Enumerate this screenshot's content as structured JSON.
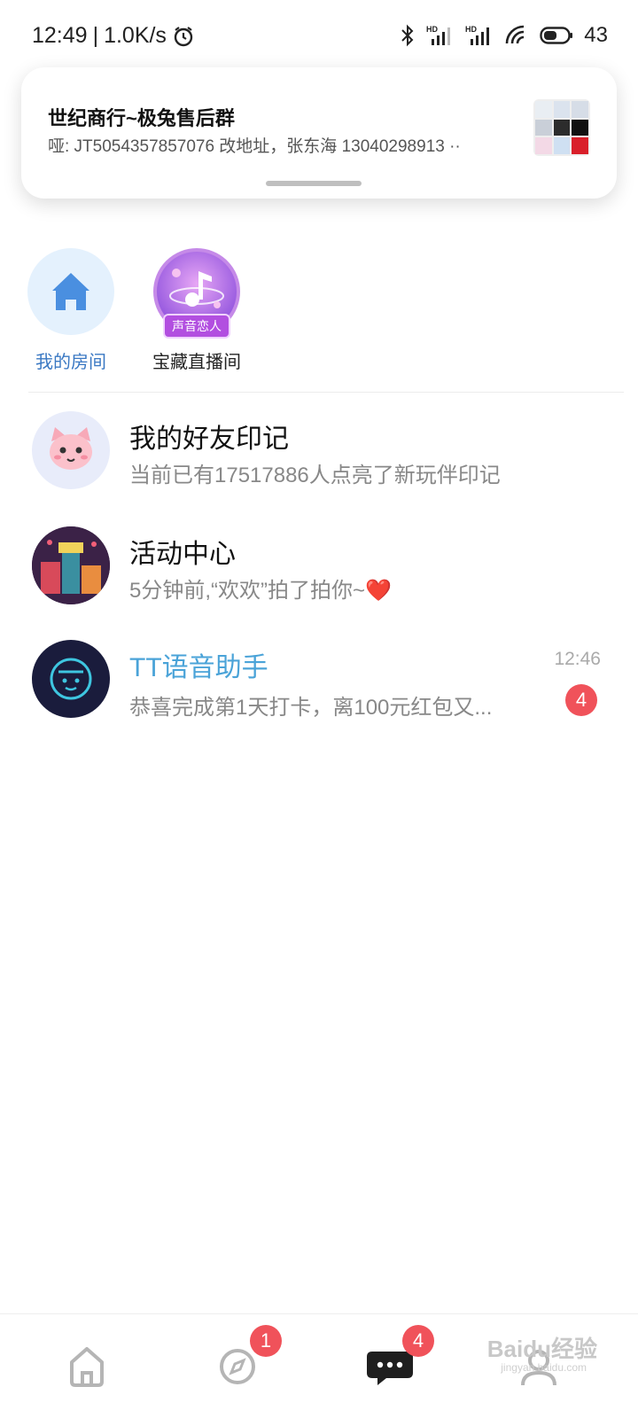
{
  "status_bar": {
    "time": "12:49",
    "speed": "1.0K/s",
    "battery": "43",
    "icons": [
      "alarm-icon",
      "bluetooth-icon",
      "signal-hd-icon",
      "signal-hd-icon",
      "wifi-icon",
      "battery-icon"
    ]
  },
  "notification": {
    "title": "世纪商行~极兔售后群",
    "body": "哑: JT5054357857076  改地址，张东海 13040298913 ··"
  },
  "rooms": [
    {
      "label": "我的房间",
      "icon": "home-icon"
    },
    {
      "label": "宝藏直播间",
      "badge": "声音恋人",
      "icon": "music-note-icon"
    }
  ],
  "conversations": [
    {
      "title": "我的好友印记",
      "subtitle": "当前已有17517886人点亮了新玩伴印记",
      "avatar": "cat-avatar"
    },
    {
      "title": "活动中心",
      "subtitle": "5分钟前,“欢欢”拍了拍你~❤️",
      "avatar": "activity-avatar"
    },
    {
      "title": "TT语音助手",
      "subtitle": "恭喜完成第1天打卡，离100元红包又...",
      "time": "12:46",
      "unread": "4",
      "avatar": "assistant-avatar"
    }
  ],
  "bottom_nav": [
    {
      "name": "home",
      "icon": "home-outline-icon"
    },
    {
      "name": "discover",
      "icon": "compass-icon",
      "badge": "1"
    },
    {
      "name": "messages",
      "icon": "chat-bubble-icon",
      "badge": "4"
    },
    {
      "name": "me",
      "icon": "profile-icon"
    }
  ],
  "watermark": {
    "text": "Baidu经验",
    "sub": "jingyan.baidu.com"
  },
  "colors": {
    "accent_blue": "#3a78c3",
    "badge_red": "#f0525a",
    "assistant_title": "#4aa3d8"
  }
}
